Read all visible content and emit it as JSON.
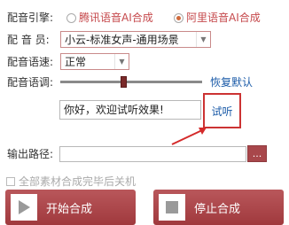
{
  "engine": {
    "label": "配音引擎:",
    "options": [
      {
        "label": "腾讯语音AI合成",
        "selected": false
      },
      {
        "label": "阿里语音AI合成",
        "selected": true
      }
    ]
  },
  "voice": {
    "label": "配 音 员:",
    "value": "小云-标准女声-通用场景"
  },
  "speed": {
    "label": "配音语速:",
    "value": "正常"
  },
  "pitch": {
    "label": "配音语调:",
    "level_percent": 42,
    "reset_label": "恢复默认"
  },
  "preview": {
    "text": "你好，欢迎试听效果!",
    "audition_label": "试听"
  },
  "output": {
    "label": "输出路径:",
    "value": "",
    "browse_label": "..."
  },
  "shutdown_option": {
    "label": "全部素材合成完毕后关机",
    "checked": false
  },
  "actions": {
    "start_label": "开始合成",
    "stop_label": "停止合成"
  },
  "colors": {
    "accent": "#a8474b",
    "link": "#1b5ba8",
    "highlight": "#cc3333"
  }
}
